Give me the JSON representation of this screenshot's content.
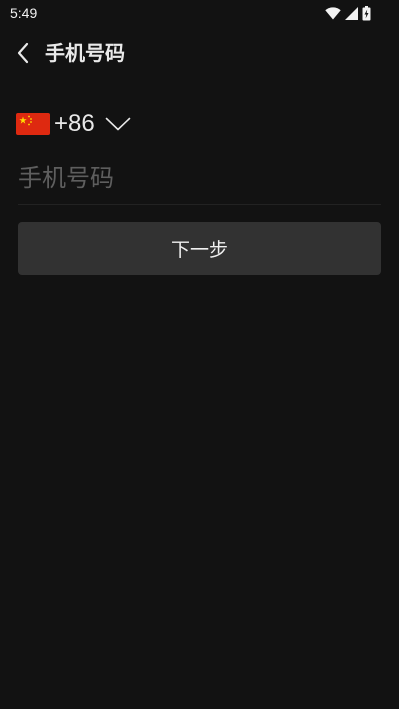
{
  "status_bar": {
    "time": "5:49",
    "icons": [
      "wifi-icon",
      "cellular-signal-icon",
      "battery-charging-icon"
    ]
  },
  "header": {
    "back_icon": "chevron-left-icon",
    "title": "手机号码"
  },
  "country_selector": {
    "flag": "china-flag-icon",
    "dial_code": "+86",
    "dropdown_icon": "chevron-down-icon"
  },
  "phone_field": {
    "value": "",
    "placeholder": "手机号码"
  },
  "next_button": {
    "label": "下一步"
  },
  "colors": {
    "background": "#121212",
    "button_bg": "#323232",
    "text_primary": "#e9e9e9",
    "placeholder": "#5e5e5e",
    "flag_red": "#de2910",
    "flag_yellow": "#ffde00"
  }
}
